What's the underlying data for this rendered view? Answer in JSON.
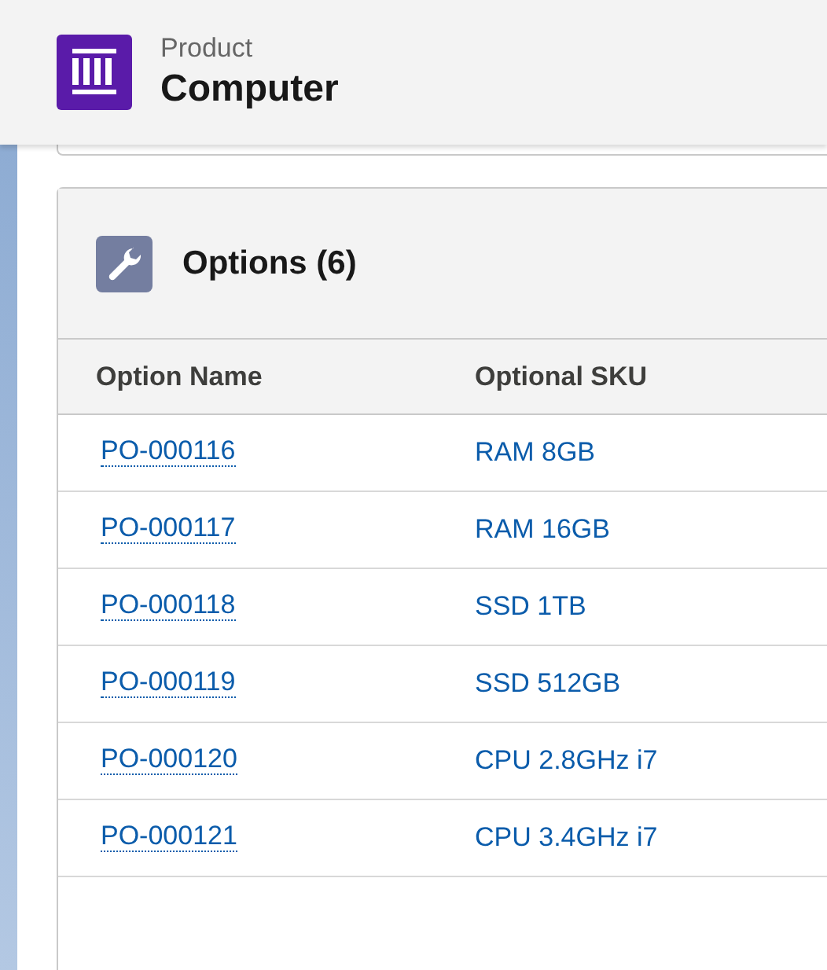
{
  "header": {
    "object_type": "Product",
    "record_name": "Computer"
  },
  "related_list": {
    "title": "Options (6)",
    "columns": [
      "Option Name",
      "Optional SKU"
    ],
    "rows": [
      {
        "name": "PO-000116",
        "sku": "RAM 8GB"
      },
      {
        "name": "PO-000117",
        "sku": "RAM 16GB"
      },
      {
        "name": "PO-000118",
        "sku": "SSD 1TB"
      },
      {
        "name": "PO-000119",
        "sku": "SSD 512GB"
      },
      {
        "name": "PO-000120",
        "sku": "CPU 2.8GHz i7"
      },
      {
        "name": "PO-000121",
        "sku": "CPU 3.4GHz i7"
      }
    ]
  }
}
